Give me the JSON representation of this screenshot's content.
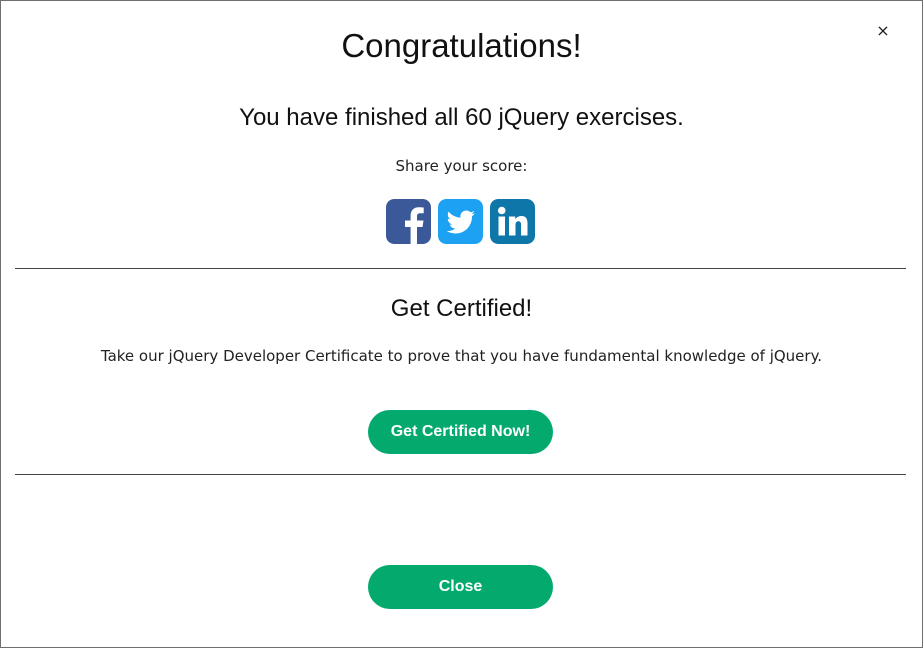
{
  "modal": {
    "close_glyph": "×",
    "title": "Congratulations!",
    "subtitle": "You have finished all 60 jQuery exercises.",
    "share_label": "Share your score:",
    "share_buttons": [
      {
        "icon": "facebook-icon",
        "color": "#3b5998"
      },
      {
        "icon": "twitter-icon",
        "color": "#1da1f2"
      },
      {
        "icon": "linkedin-icon",
        "color": "#0e76a8"
      }
    ],
    "certificate": {
      "title": "Get Certified!",
      "description": "Take our jQuery Developer Certificate to prove that you have fundamental knowledge of jQuery.",
      "button_label": "Get Certified Now!"
    },
    "close_button_label": "Close",
    "accent_color": "#04aa6d"
  }
}
